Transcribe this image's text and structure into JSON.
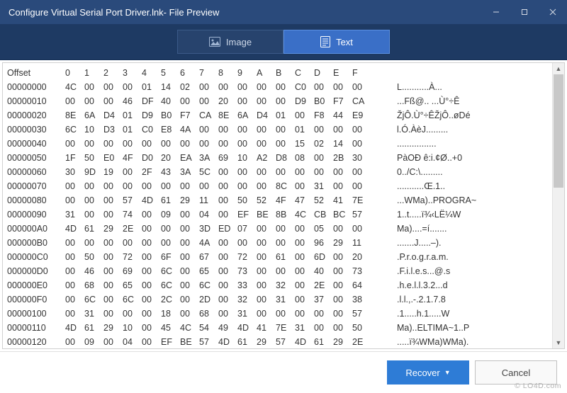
{
  "window": {
    "title": "Configure Virtual Serial Port Driver.lnk- File Preview",
    "min_icon": "minimize-icon",
    "max_icon": "maximize-icon",
    "close_icon": "close-icon"
  },
  "tabs": {
    "image": {
      "label": "Image",
      "active": false
    },
    "text": {
      "label": "Text",
      "active": true
    }
  },
  "buttons": {
    "recover": "Recover",
    "cancel": "Cancel"
  },
  "hex": {
    "header_offset": "Offset",
    "header_cols": [
      "0",
      "1",
      "2",
      "3",
      "4",
      "5",
      "6",
      "7",
      "8",
      "9",
      "A",
      "B",
      "C",
      "D",
      "E",
      "F"
    ],
    "rows": [
      {
        "offset": "00000000",
        "bytes": [
          "4C",
          "00",
          "00",
          "00",
          "01",
          "14",
          "02",
          "00",
          "00",
          "00",
          "00",
          "00",
          "C0",
          "00",
          "00",
          "00"
        ],
        "ascii": "L...........À..."
      },
      {
        "offset": "00000010",
        "bytes": [
          "00",
          "00",
          "00",
          "46",
          "DF",
          "40",
          "00",
          "00",
          "20",
          "00",
          "00",
          "00",
          "D9",
          "B0",
          "F7",
          "CA"
        ],
        "ascii": "...Fß@.. ...Ù°÷Ê"
      },
      {
        "offset": "00000020",
        "bytes": [
          "8E",
          "6A",
          "D4",
          "01",
          "D9",
          "B0",
          "F7",
          "CA",
          "8E",
          "6A",
          "D4",
          "01",
          "00",
          "F8",
          "44",
          "E9"
        ],
        "ascii": "ŽjÔ.Ù°÷ÊŽjÔ..øDé"
      },
      {
        "offset": "00000030",
        "bytes": [
          "6C",
          "10",
          "D3",
          "01",
          "C0",
          "E8",
          "4A",
          "00",
          "00",
          "00",
          "00",
          "00",
          "01",
          "00",
          "00",
          "00"
        ],
        "ascii": "l.Ó.ÀèJ........."
      },
      {
        "offset": "00000040",
        "bytes": [
          "00",
          "00",
          "00",
          "00",
          "00",
          "00",
          "00",
          "00",
          "00",
          "00",
          "00",
          "00",
          "15",
          "02",
          "14",
          "00"
        ],
        "ascii": "................"
      },
      {
        "offset": "00000050",
        "bytes": [
          "1F",
          "50",
          "E0",
          "4F",
          "D0",
          "20",
          "EA",
          "3A",
          "69",
          "10",
          "A2",
          "D8",
          "08",
          "00",
          "2B",
          "30"
        ],
        "ascii": "PàOÐ ê:i.¢Ø..+0"
      },
      {
        "offset": "00000060",
        "bytes": [
          "30",
          "9D",
          "19",
          "00",
          "2F",
          "43",
          "3A",
          "5C",
          "00",
          "00",
          "00",
          "00",
          "00",
          "00",
          "00",
          "00"
        ],
        "ascii": "0../C:\\........."
      },
      {
        "offset": "00000070",
        "bytes": [
          "00",
          "00",
          "00",
          "00",
          "00",
          "00",
          "00",
          "00",
          "00",
          "00",
          "00",
          "8C",
          "00",
          "31",
          "00",
          "00"
        ],
        "ascii": "...........Œ.1.."
      },
      {
        "offset": "00000080",
        "bytes": [
          "00",
          "00",
          "00",
          "57",
          "4D",
          "61",
          "29",
          "11",
          "00",
          "50",
          "52",
          "4F",
          "47",
          "52",
          "41",
          "7E"
        ],
        "ascii": "...WMa)..PROGRA~"
      },
      {
        "offset": "00000090",
        "bytes": [
          "31",
          "00",
          "00",
          "74",
          "00",
          "09",
          "00",
          "04",
          "00",
          "EF",
          "BE",
          "8B",
          "4C",
          "CB",
          "BC",
          "57"
        ],
        "ascii": "1..t.....ï¾‹LË¼W"
      },
      {
        "offset": "000000A0",
        "bytes": [
          "4D",
          "61",
          "29",
          "2E",
          "00",
          "00",
          "00",
          "3D",
          "ED",
          "07",
          "00",
          "00",
          "00",
          "05",
          "00",
          "00"
        ],
        "ascii": "Ma)....=í......."
      },
      {
        "offset": "000000B0",
        "bytes": [
          "00",
          "00",
          "00",
          "00",
          "00",
          "00",
          "00",
          "4A",
          "00",
          "00",
          "00",
          "00",
          "00",
          "96",
          "29",
          "11"
        ],
        "ascii": ".......J.....–)."
      },
      {
        "offset": "000000C0",
        "bytes": [
          "00",
          "50",
          "00",
          "72",
          "00",
          "6F",
          "00",
          "67",
          "00",
          "72",
          "00",
          "61",
          "00",
          "6D",
          "00",
          "20"
        ],
        "ascii": ".P.r.o.g.r.a.m. "
      },
      {
        "offset": "000000D0",
        "bytes": [
          "00",
          "46",
          "00",
          "69",
          "00",
          "6C",
          "00",
          "65",
          "00",
          "73",
          "00",
          "00",
          "00",
          "40",
          "00",
          "73"
        ],
        "ascii": ".F.i.l.e.s...@.s"
      },
      {
        "offset": "000000E0",
        "bytes": [
          "00",
          "68",
          "00",
          "65",
          "00",
          "6C",
          "00",
          "6C",
          "00",
          "33",
          "00",
          "32",
          "00",
          "2E",
          "00",
          "64"
        ],
        "ascii": ".h.e.l.l.3.2...d"
      },
      {
        "offset": "000000F0",
        "bytes": [
          "00",
          "6C",
          "00",
          "6C",
          "00",
          "2C",
          "00",
          "2D",
          "00",
          "32",
          "00",
          "31",
          "00",
          "37",
          "00",
          "38"
        ],
        "ascii": ".l.l.,.-.2.1.7.8"
      },
      {
        "offset": "00000100",
        "bytes": [
          "00",
          "31",
          "00",
          "00",
          "00",
          "18",
          "00",
          "68",
          "00",
          "31",
          "00",
          "00",
          "00",
          "00",
          "00",
          "57"
        ],
        "ascii": ".1.....h.1.....W"
      },
      {
        "offset": "00000110",
        "bytes": [
          "4D",
          "61",
          "29",
          "10",
          "00",
          "45",
          "4C",
          "54",
          "49",
          "4D",
          "41",
          "7E",
          "31",
          "00",
          "00",
          "50"
        ],
        "ascii": "Ma)..ELTIMA~1..P"
      },
      {
        "offset": "00000120",
        "bytes": [
          "00",
          "09",
          "00",
          "04",
          "00",
          "EF",
          "BE",
          "57",
          "4D",
          "61",
          "29",
          "57",
          "4D",
          "61",
          "29",
          "2E"
        ],
        "ascii": ".....ï¾WMa)WMa)."
      }
    ]
  },
  "watermark": "© LO4D.com"
}
